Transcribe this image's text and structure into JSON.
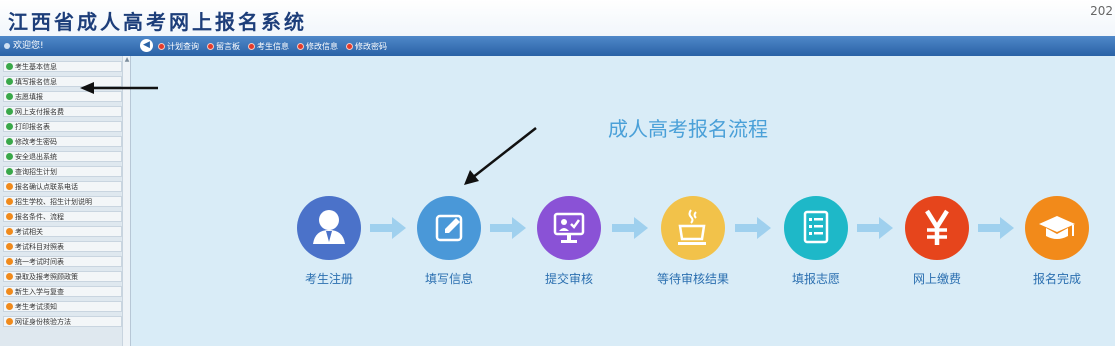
{
  "header": {
    "site_title": "江西省成人高考网上报名系统",
    "year_fragment": "202"
  },
  "navbar": {
    "welcome": "欢迎您!",
    "back_icon": "circle-arrow-left-icon",
    "items": [
      {
        "label": "计划查询"
      },
      {
        "label": "留言板"
      },
      {
        "label": "考生信息"
      },
      {
        "label": "修改信息"
      },
      {
        "label": "修改密码"
      }
    ]
  },
  "sidebar": {
    "items": [
      {
        "label": "考生基本信息",
        "icon": "green"
      },
      {
        "label": "填写报名信息",
        "icon": "green"
      },
      {
        "label": "志愿填报",
        "icon": "green"
      },
      {
        "label": "网上支付报名费",
        "icon": "green"
      },
      {
        "label": "打印报名表",
        "icon": "green"
      },
      {
        "label": "修改考生密码",
        "icon": "green"
      },
      {
        "label": "安全退出系统",
        "icon": "green"
      },
      {
        "label": "查询招生计划",
        "icon": "green"
      },
      {
        "label": "报名确认点联系电话",
        "icon": "orange"
      },
      {
        "label": "招生学校、招生计划说明",
        "icon": "orange"
      },
      {
        "label": "报名条件、流程",
        "icon": "orange"
      },
      {
        "label": "考试相关",
        "icon": "orange"
      },
      {
        "label": "考试科目对照表",
        "icon": "orange"
      },
      {
        "label": "统一考试时间表",
        "icon": "orange"
      },
      {
        "label": "录取及报考照顾政策",
        "icon": "orange"
      },
      {
        "label": "新生入学与复查",
        "icon": "orange"
      },
      {
        "label": "考生考试须知",
        "icon": "orange"
      },
      {
        "label": "网证身份核验方法",
        "icon": "orange"
      }
    ]
  },
  "main": {
    "flow_title": "成人高考报名流程",
    "steps": [
      {
        "label": "考生注册",
        "icon": "user-icon",
        "color": "#4b72c9"
      },
      {
        "label": "填写信息",
        "icon": "edit-icon",
        "color": "#4a98d8"
      },
      {
        "label": "提交审核",
        "icon": "submit-review-icon",
        "color": "#8a52d6"
      },
      {
        "label": "等待审核结果",
        "icon": "coffee-cup-icon",
        "color": "#f2c24a"
      },
      {
        "label": "填报志愿",
        "icon": "checklist-icon",
        "color": "#1eb8c8"
      },
      {
        "label": "网上缴费",
        "icon": "yen-icon",
        "color": "#e6451c"
      },
      {
        "label": "报名完成",
        "icon": "graduation-cap-icon",
        "color": "#f28a1a"
      }
    ],
    "arrow_color": "#9fd0ee"
  }
}
